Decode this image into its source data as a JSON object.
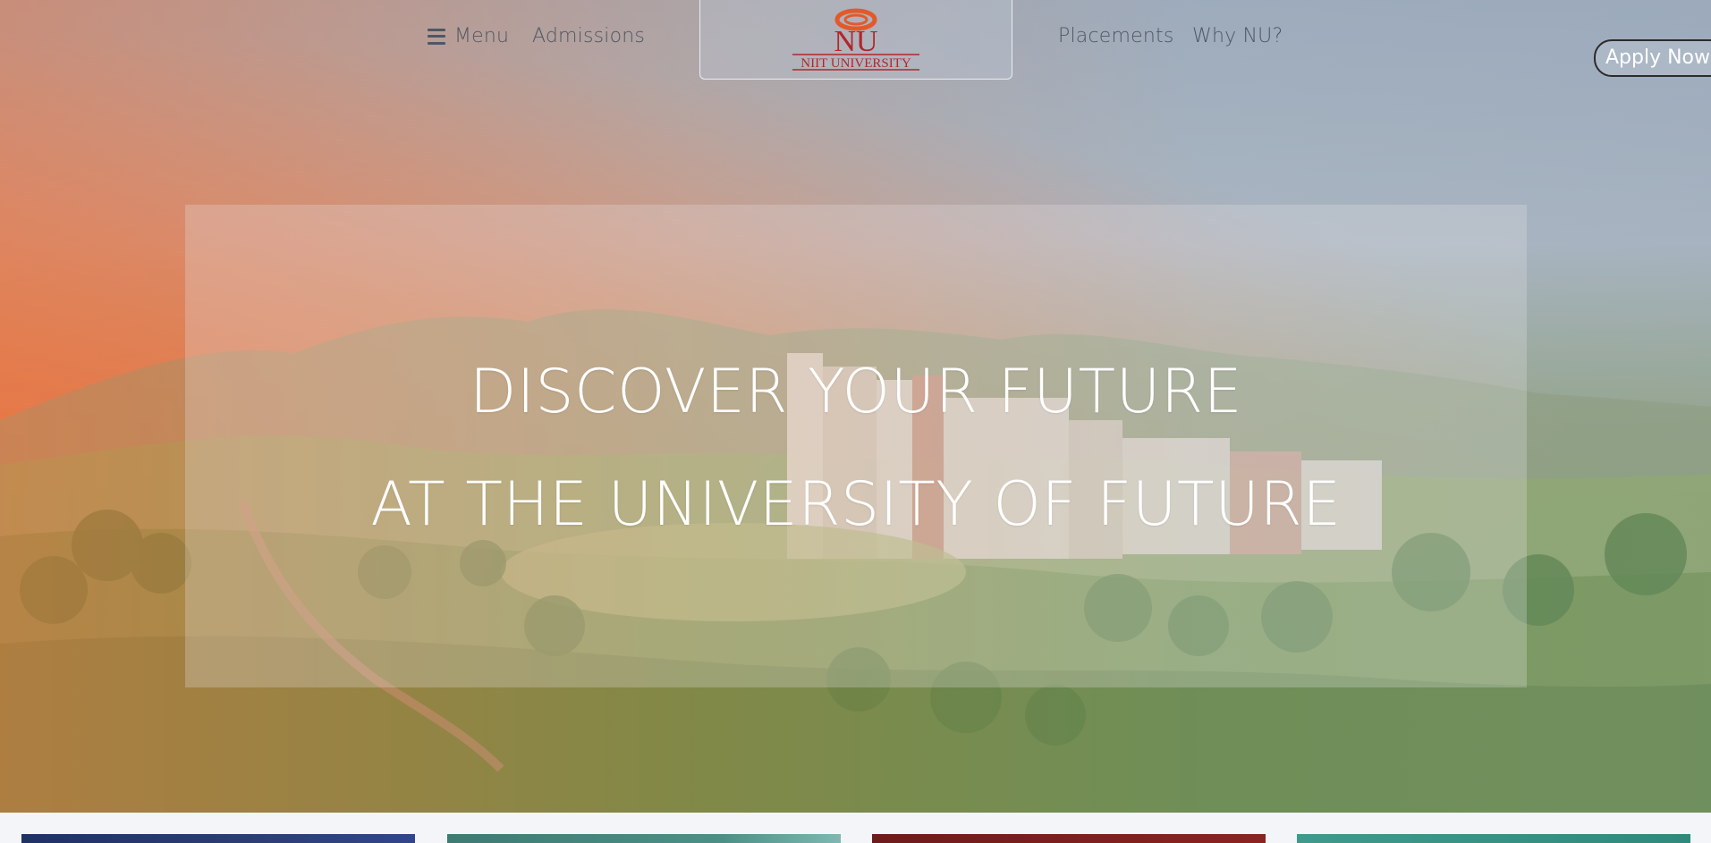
{
  "nav": {
    "menu_label": "Menu",
    "admissions_label": "Admissions",
    "placements_label": "Placements",
    "why_label": "Why NU?",
    "apply_label": "Apply Now"
  },
  "logo": {
    "monogram": "NU",
    "name": "NIIT UNIVERSITY",
    "brand_color": "#b3262a"
  },
  "hero": {
    "line_1": "DISCOVER YOUR FUTURE",
    "line_2": "AT THE UNIVERSITY OF FUTURE"
  },
  "icons": {
    "menu": "hamburger-icon"
  },
  "colors": {
    "nav_text": "#4f5763",
    "headline_text": "#ffffff",
    "card_1": "#1f3266",
    "card_2": "#3f7a73",
    "card_3": "#6e1b1b",
    "card_4": "#3f9a8c"
  }
}
